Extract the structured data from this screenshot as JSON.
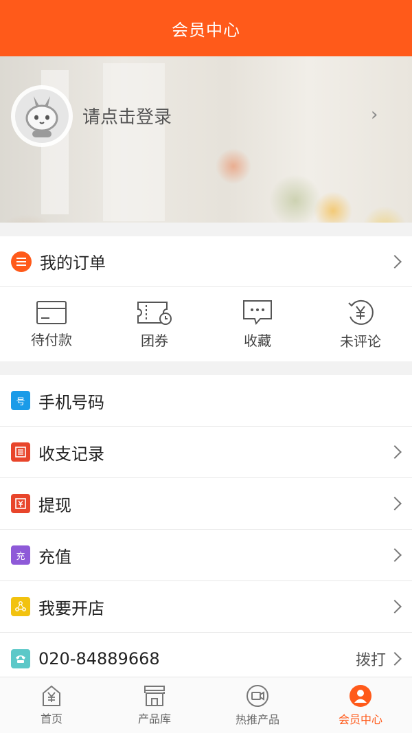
{
  "header": {
    "title": "会员中心"
  },
  "profile": {
    "login_prompt": "请点击登录"
  },
  "orders": {
    "title": "我的订单",
    "tabs": [
      {
        "label": "待付款",
        "icon": "card-icon"
      },
      {
        "label": "团券",
        "icon": "ticket-icon"
      },
      {
        "label": "收藏",
        "icon": "chat-bubble-icon"
      },
      {
        "label": "未评论",
        "icon": "yen-refresh-icon"
      }
    ]
  },
  "menu": {
    "phone": {
      "label": "手机号码",
      "icon": "phone-number-icon",
      "color": "#1a9be8"
    },
    "records": {
      "label": "收支记录",
      "icon": "ledger-icon",
      "color": "#e8452b"
    },
    "withdraw": {
      "label": "提现",
      "icon": "withdraw-icon",
      "color": "#e8452b"
    },
    "recharge": {
      "label": "充值",
      "icon": "recharge-icon",
      "color": "#8e5ad8"
    },
    "open_store": {
      "label": "我要开店",
      "icon": "store-network-icon",
      "color": "#f2c20f"
    },
    "hotline": {
      "number": "020-84889668",
      "action": "拨打",
      "icon": "telephone-icon",
      "color": "#5cc8c8"
    }
  },
  "tabbar": {
    "items": [
      {
        "label": "首页",
        "icon": "home-icon"
      },
      {
        "label": "产品库",
        "icon": "shop-icon"
      },
      {
        "label": "热推产品",
        "icon": "camera-badge-icon"
      },
      {
        "label": "会员中心",
        "icon": "user-icon",
        "active": true
      }
    ]
  },
  "colors": {
    "accent": "#ff5a1a",
    "background": "#f2f2f2"
  }
}
